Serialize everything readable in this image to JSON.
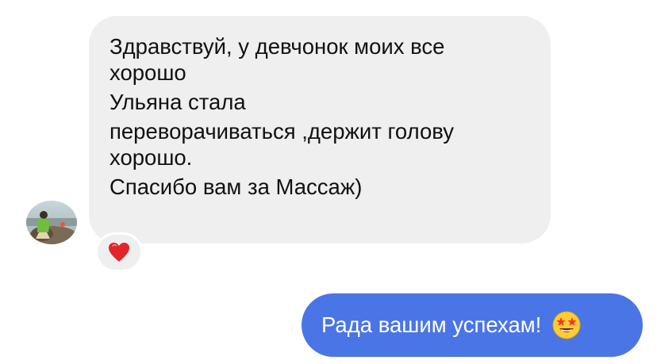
{
  "incoming_message": {
    "lines": [
      "Здравствуй, у девчонок моих все",
      "хорошо",
      "Ульяна стала",
      "переворачиваться ,держит голову",
      "хорошо.",
      "Спасибо вам за Массаж)"
    ],
    "reaction_icon": "red-heart",
    "bubble_color": "#efefef"
  },
  "outgoing_message": {
    "text": "Рада вашим успехам!",
    "emoji_icon": "star-struck-emoji",
    "bubble_color": "#4a75e6"
  },
  "avatar_icon": "contact-avatar-photo"
}
